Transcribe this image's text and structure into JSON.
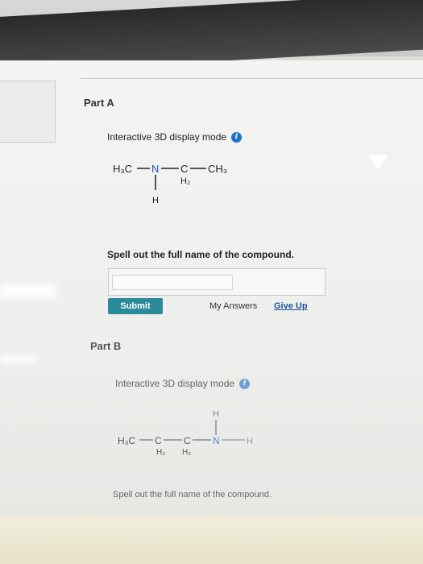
{
  "part_a": {
    "label": "Part A",
    "display_mode": "Interactive 3D display mode",
    "info_icon": "i",
    "molecule": {
      "left_group": "H₃C",
      "n": "N",
      "c": "C",
      "ch3": "CH₃",
      "h2": "H₂",
      "h": "H"
    },
    "question": "Spell out the full name of the compound.",
    "answer_value": "",
    "submit_label": "Submit",
    "my_answers_label": "My Answers",
    "give_up_label": "Give Up"
  },
  "part_b": {
    "label": "Part B",
    "display_mode": "Interactive 3D display mode",
    "info_icon": "i",
    "molecule": {
      "left_group": "H₃C",
      "c1": "C",
      "c2": "C",
      "n": "N",
      "h_top": "H",
      "h_right": "H",
      "h2_1": "H₂",
      "h2_2": "H₂"
    },
    "question": "Spell out the full name of the compound."
  },
  "colors": {
    "accent_button": "#2a8a9a",
    "info_icon": "#1d72c9",
    "link": "#1c4f9c"
  }
}
